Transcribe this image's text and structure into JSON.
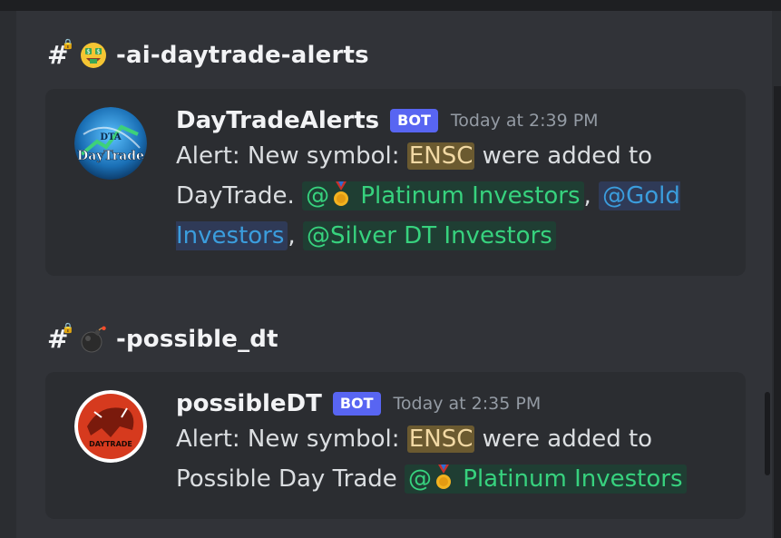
{
  "channels": [
    {
      "name": "-ai-daytrade-alerts",
      "message": {
        "username": "DayTradeAlerts",
        "bot_label": "BOT",
        "timestamp": "Today at 2:39 PM",
        "text_prefix": "Alert:  New symbol: ",
        "ticker": "ENSC",
        "text_mid": " were added to DayTrade. ",
        "mention_platinum_at": "@",
        "mention_platinum": " Platinum Investors",
        "sep1": ", ",
        "mention_gold": "@Gold Investors",
        "sep2": ", ",
        "mention_silver": "@Silver DT Investors",
        "avatar_text": "DayTrade",
        "avatar_small": "DTA"
      }
    },
    {
      "name": "-possible_dt",
      "message": {
        "username": "possibleDT",
        "bot_label": "BOT",
        "timestamp": "Today at 2:35 PM",
        "text_prefix": "Alert:  New symbol: ",
        "ticker": "ENSC",
        "text_mid": " were added to Possible Day Trade ",
        "mention_platinum_at": "@",
        "mention_platinum": " Platinum Investors",
        "avatar_text": "DAYTRADE"
      }
    }
  ],
  "icons": {
    "hash": "#",
    "money_face": "money-mouth-face-icon",
    "bomb": "bomb-icon",
    "medal": "military-medal-icon"
  },
  "colors": {
    "bg": "#313338",
    "card": "#2b2d31",
    "bot_badge": "#5865f2",
    "mention_green": "#37d27e",
    "mention_blue": "#3b9ddd"
  }
}
